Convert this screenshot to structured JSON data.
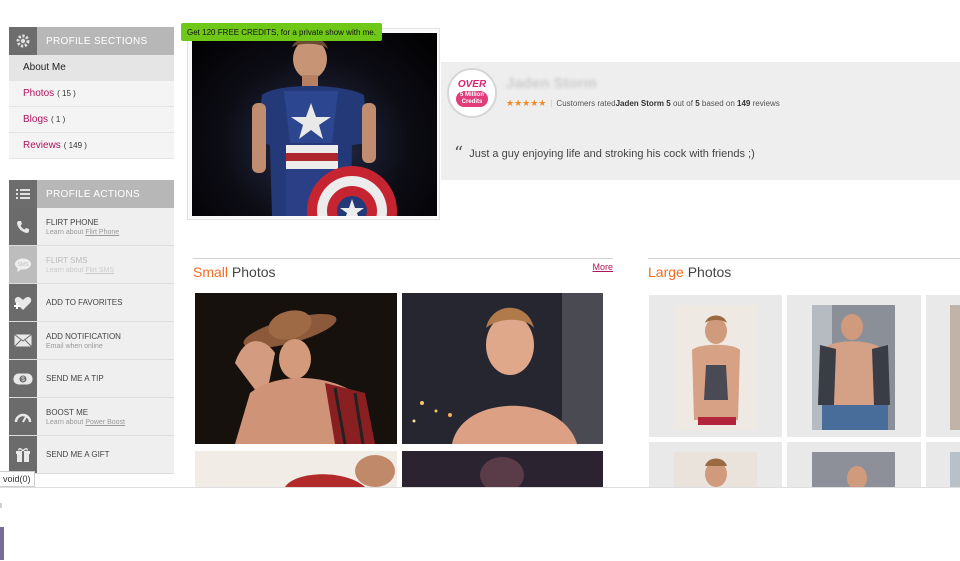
{
  "profile_sections": {
    "header": "PROFILE SECTIONS",
    "items": [
      {
        "label": "About Me",
        "count": ""
      },
      {
        "label": "Photos",
        "count": "( 15 )"
      },
      {
        "label": "Blogs",
        "count": "( 1 )"
      },
      {
        "label": "Reviews",
        "count": "( 149 )"
      }
    ]
  },
  "profile_actions": {
    "header": "PROFILE ACTIONS",
    "items": [
      {
        "title": "FLIRT PHONE",
        "sub_prefix": "Learn about ",
        "sub_link": "Flirt Phone",
        "icon": "phone-icon",
        "faded": false
      },
      {
        "title": "FLIRT SMS",
        "sub_prefix": "Learn about ",
        "sub_link": "Flirt SMS",
        "icon": "sms-icon",
        "faded": true
      },
      {
        "title": "ADD TO FAVORITES",
        "sub_prefix": "",
        "sub_link": "",
        "icon": "heart-icon",
        "faded": false
      },
      {
        "title": "ADD NOTIFICATION",
        "sub_prefix": "Email when online",
        "sub_link": "",
        "icon": "envelope-icon",
        "faded": false
      },
      {
        "title": "SEND ME A TIP",
        "sub_prefix": "",
        "sub_link": "",
        "icon": "money-icon",
        "faded": false
      },
      {
        "title": "BOOST ME",
        "sub_prefix": "Learn about ",
        "sub_link": "Power Boost",
        "icon": "gauge-icon",
        "faded": false
      },
      {
        "title": "SEND ME A GIFT",
        "sub_prefix": "",
        "sub_link": "",
        "icon": "gift-icon",
        "faded": false
      }
    ]
  },
  "hero": {
    "credits_tooltip": "Get 120 FREE CREDITS, for a private show with me."
  },
  "info": {
    "badge_top": "OVER",
    "badge_line1": "5 Million",
    "badge_line2": "Credits",
    "model_name": "Jaden Storm",
    "stars": "★★★★★",
    "rating_prefix": "Customers rated ",
    "rating_name": "Jaden Storm",
    "rating_score": "5",
    "rating_mid": " out of ",
    "rating_max": "5",
    "rating_based": " based on ",
    "rating_reviews": "149",
    "rating_suffix": " reviews",
    "quote_mark": "“",
    "quote": "Just a guy enjoying life and stroking his cock with friends ;)"
  },
  "small_photos": {
    "accent": "Small",
    "rest": " Photos",
    "more": "More"
  },
  "large_photos": {
    "accent": "Large",
    "rest": " Photos"
  },
  "footer": {
    "void_label": "void(0)",
    "tiny_mark": "I"
  },
  "colors": {
    "accent_orange": "#f26b21",
    "link_magenta": "#b0125b",
    "tooltip_green": "#6fc718",
    "star_orange": "#f08a24"
  }
}
